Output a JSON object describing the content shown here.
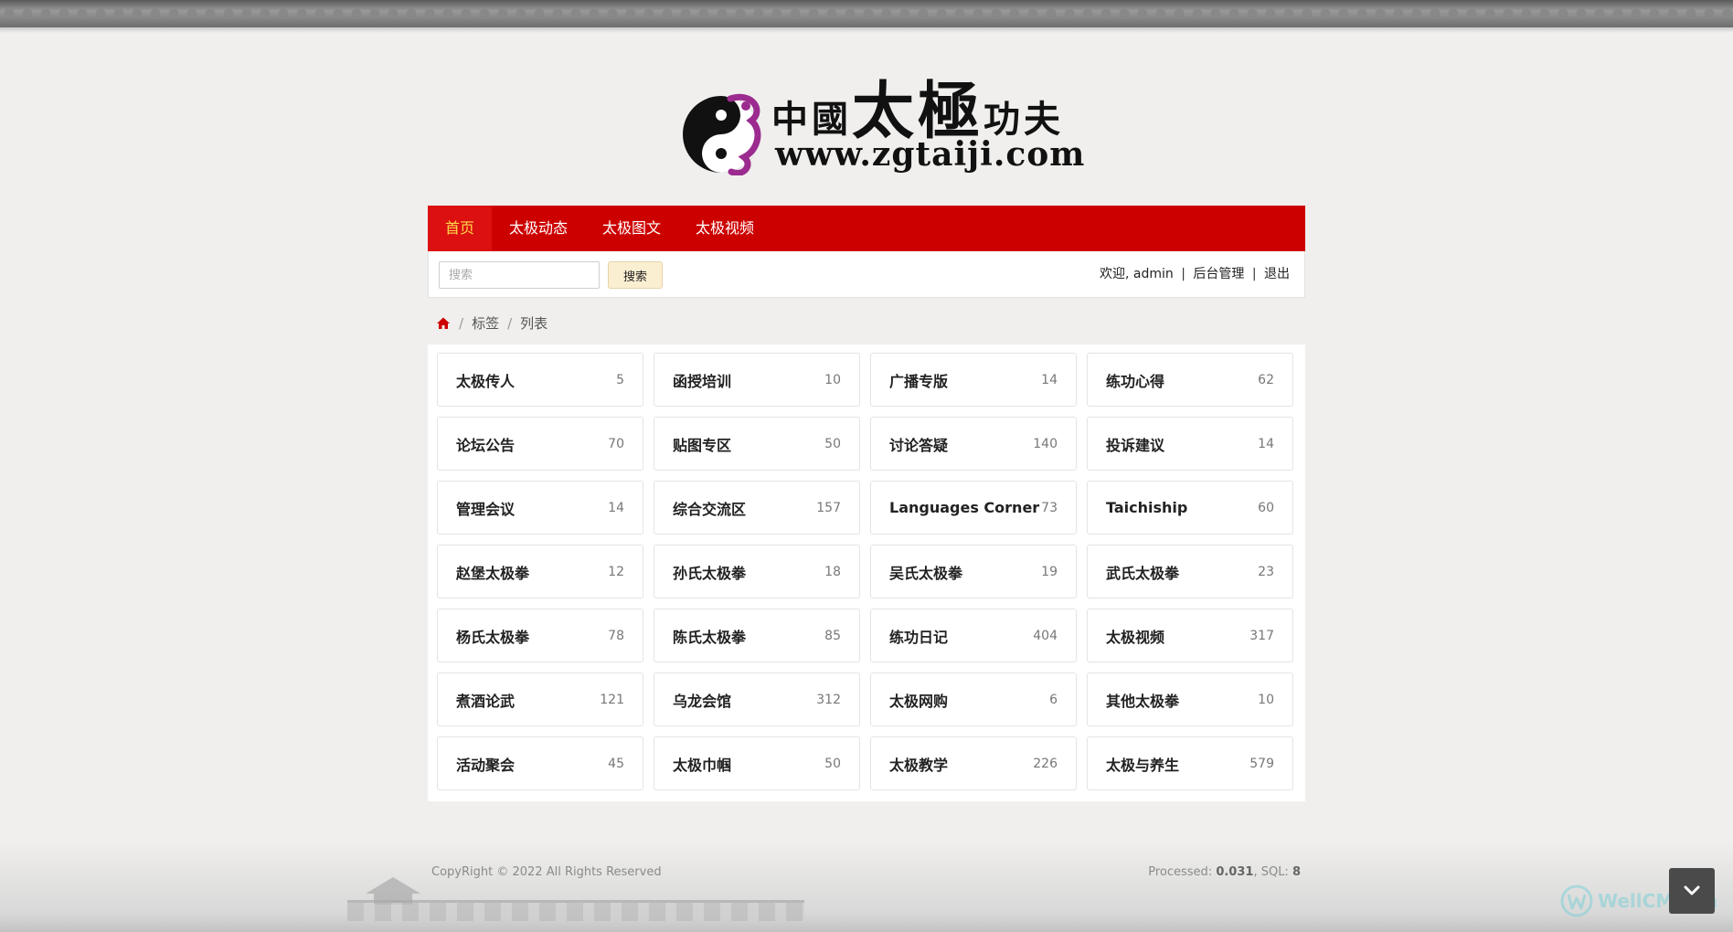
{
  "logo": {
    "chars_small_left": [
      "中",
      "國"
    ],
    "chars_big": [
      "太",
      "極"
    ],
    "chars_small_right": [
      "功",
      "夫"
    ],
    "url": "www.zgtaiji.com"
  },
  "nav": {
    "items": [
      {
        "label": "首页",
        "active": true
      },
      {
        "label": "太极动态",
        "active": false
      },
      {
        "label": "太极图文",
        "active": false
      },
      {
        "label": "太极视频",
        "active": false
      }
    ]
  },
  "search": {
    "placeholder": "搜索",
    "value": "",
    "button_label": "搜索"
  },
  "user": {
    "welcome": "欢迎, admin",
    "admin_link": "后台管理",
    "logout_link": "退出",
    "separator": "|"
  },
  "breadcrumb": {
    "separator": "/",
    "items": [
      "标签",
      "列表"
    ]
  },
  "tags": [
    {
      "name": "太极传人",
      "count": "5"
    },
    {
      "name": "函授培训",
      "count": "10"
    },
    {
      "name": "广播专版",
      "count": "14"
    },
    {
      "name": "练功心得",
      "count": "62"
    },
    {
      "name": "论坛公告",
      "count": "70"
    },
    {
      "name": "贴图专区",
      "count": "50"
    },
    {
      "name": "讨论答疑",
      "count": "140"
    },
    {
      "name": "投诉建议",
      "count": "14"
    },
    {
      "name": "管理会议",
      "count": "14"
    },
    {
      "name": "综合交流区",
      "count": "157"
    },
    {
      "name": "Languages Corner",
      "count": "73"
    },
    {
      "name": "Taichiship",
      "count": "60"
    },
    {
      "name": "赵堡太极拳",
      "count": "12"
    },
    {
      "name": "孙氏太极拳",
      "count": "18"
    },
    {
      "name": "吴氏太极拳",
      "count": "19"
    },
    {
      "name": "武氏太极拳",
      "count": "23"
    },
    {
      "name": "杨氏太极拳",
      "count": "78"
    },
    {
      "name": "陈氏太极拳",
      "count": "85"
    },
    {
      "name": "练功日记",
      "count": "404"
    },
    {
      "name": "太极视频",
      "count": "317"
    },
    {
      "name": "煮酒论武",
      "count": "121"
    },
    {
      "name": "乌龙会馆",
      "count": "312"
    },
    {
      "name": "太极网购",
      "count": "6"
    },
    {
      "name": "其他太极拳",
      "count": "10"
    },
    {
      "name": "活动聚会",
      "count": "45"
    },
    {
      "name": "太极巾帼",
      "count": "50"
    },
    {
      "name": "太极教学",
      "count": "226"
    },
    {
      "name": "太极与养生",
      "count": "579"
    }
  ],
  "footer": {
    "copyright": "CopyRight © 2022 All Rights Reserved",
    "processed_label": "Processed:",
    "processed_value": "0.031",
    "sql_label": "SQL:",
    "sql_value": "8"
  },
  "watermark": {
    "text": "WellCMS.cn"
  },
  "colors": {
    "nav_bg": "#cd0000",
    "nav_active_text": "#ffd94a",
    "search_button_bg": "#fbefd2",
    "home_icon": "#cd0000",
    "logo_purple": "#9b2b8f"
  },
  "icons": {
    "home": "home-icon",
    "scroll": "chevron-down-icon",
    "logo": "yin-yang-dragon-icon"
  }
}
